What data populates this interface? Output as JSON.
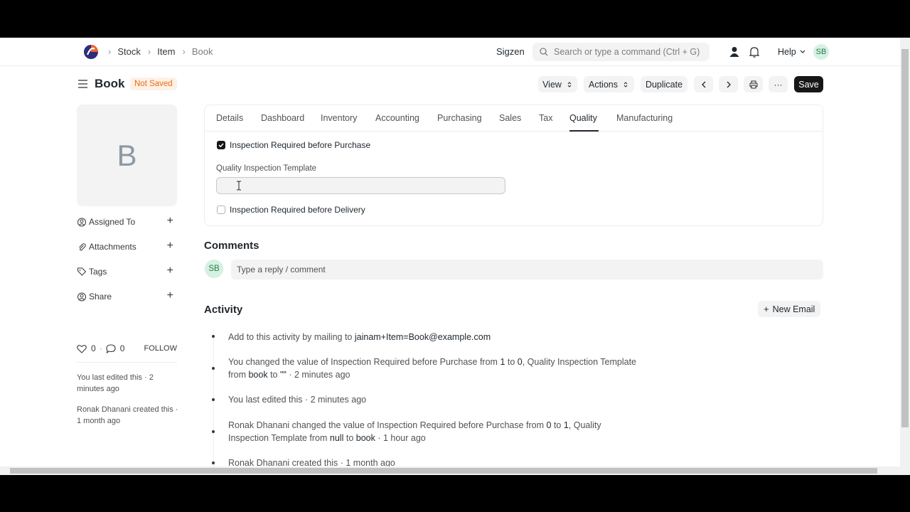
{
  "navbar": {
    "breadcrumbs": [
      "Stock",
      "Item",
      "Book"
    ],
    "company": "Sigzen",
    "search_placeholder": "Search or type a command (Ctrl + G)",
    "help_label": "Help",
    "user_initials": "SB"
  },
  "page": {
    "title": "Book",
    "status_badge": "Not Saved",
    "buttons": {
      "view": "View",
      "actions": "Actions",
      "duplicate": "Duplicate",
      "save": "Save"
    }
  },
  "sidebar": {
    "image_letter": "B",
    "items": [
      {
        "label": "Assigned To"
      },
      {
        "label": "Attachments"
      },
      {
        "label": "Tags"
      },
      {
        "label": "Share"
      }
    ],
    "likes": "0",
    "comments": "0",
    "follow_label": "FOLLOW",
    "last_edited": "You last edited this · 2 minutes ago",
    "created": "Ronak Dhanani created this · 1 month ago"
  },
  "tabs": [
    "Details",
    "Dashboard",
    "Inventory",
    "Accounting",
    "Purchasing",
    "Sales",
    "Tax",
    "Quality",
    "Manufacturing"
  ],
  "active_tab": "Quality",
  "quality": {
    "inspection_purchase_label": "Inspection Required before Purchase",
    "inspection_purchase_checked": true,
    "template_label": "Quality Inspection Template",
    "template_value": "",
    "inspection_delivery_label": "Inspection Required before Delivery",
    "inspection_delivery_checked": false
  },
  "comments": {
    "title": "Comments",
    "user_initials": "SB",
    "placeholder": "Type a reply / comment"
  },
  "activity": {
    "title": "Activity",
    "new_email_label": "New Email",
    "mail_prefix": "Add to this activity by mailing to ",
    "mail_address": "jainam+Item=Book@example.com",
    "entry1_a": "You changed the value of Inspection Required before Purchase from ",
    "entry1_b": "1",
    "entry1_c": " to ",
    "entry1_d": "0",
    "entry1_e": ", Quality Inspection Template from ",
    "entry1_f": "book",
    "entry1_g": " to ",
    "entry1_h": "\"\"",
    "entry1_time": " · 2 minutes ago",
    "entry2": "You last edited this · 2 minutes ago",
    "entry3_a": "Ronak Dhanani changed the value of Inspection Required before Purchase from ",
    "entry3_b": "0",
    "entry3_c": " to ",
    "entry3_d": "1",
    "entry3_e": ", Quality Inspection Template from ",
    "entry3_f": "null",
    "entry3_g": " to ",
    "entry3_h": "book",
    "entry3_time": " · 1 hour ago",
    "entry4": "Ronak Dhanani created this · 1 month ago"
  }
}
